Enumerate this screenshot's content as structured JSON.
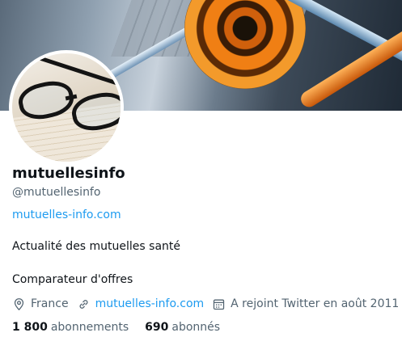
{
  "profile": {
    "name": "mutuellesinfo",
    "handle": "@mutuellesinfo",
    "website": "mutuelles-info.com",
    "bio_line1": "Actualité des mutuelles santé",
    "bio_line2": "Comparateur d'offres",
    "location": "France",
    "meta_link": "mutuelles-info.com",
    "joined": "A rejoint Twitter en août 2011",
    "following_count": "1 800",
    "following_label": "abonnements",
    "followers_count": "690",
    "followers_label": "abonnés"
  },
  "colors": {
    "link": "#1d9bf0",
    "secondary_text": "#536471",
    "primary_text": "#0f1419"
  },
  "icons": [
    "location-icon",
    "link-icon",
    "calendar-icon"
  ]
}
